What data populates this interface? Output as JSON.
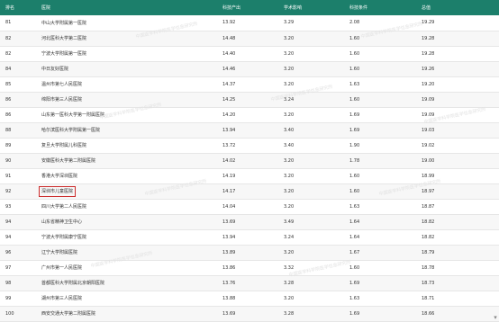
{
  "headers": [
    "排名",
    "医院",
    "科技产出",
    "学术影响",
    "科技条件",
    "总值"
  ],
  "rows": [
    {
      "rank": "81",
      "name": "中山大学附属第一医院",
      "a": "13.92",
      "b": "3.29",
      "c": "2.08",
      "d": "19.29"
    },
    {
      "rank": "82",
      "name": "河北医科大学第二医院",
      "a": "14.48",
      "b": "3.20",
      "c": "1.60",
      "d": "19.28"
    },
    {
      "rank": "82",
      "name": "宁波大学附属第一医院",
      "a": "14.40",
      "b": "3.20",
      "c": "1.60",
      "d": "19.28"
    },
    {
      "rank": "84",
      "name": "中日友好医院",
      "a": "14.46",
      "b": "3.20",
      "c": "1.60",
      "d": "19.26"
    },
    {
      "rank": "85",
      "name": "温州市第七人民医院",
      "a": "14.37",
      "b": "3.20",
      "c": "1.63",
      "d": "19.20"
    },
    {
      "rank": "86",
      "name": "绵阳市第三人民医院",
      "a": "14.25",
      "b": "3.24",
      "c": "1.60",
      "d": "19.09"
    },
    {
      "rank": "86",
      "name": "山东第一医科大学第一附属医院",
      "a": "14.20",
      "b": "3.20",
      "c": "1.69",
      "d": "19.09"
    },
    {
      "rank": "88",
      "name": "哈尔滨医科大学附属第一医院",
      "a": "13.94",
      "b": "3.40",
      "c": "1.69",
      "d": "19.03"
    },
    {
      "rank": "89",
      "name": "复旦大学附属儿科医院",
      "a": "13.72",
      "b": "3.40",
      "c": "1.90",
      "d": "19.02"
    },
    {
      "rank": "90",
      "name": "安徽医科大学第二附属医院",
      "a": "14.02",
      "b": "3.20",
      "c": "1.78",
      "d": "19.00"
    },
    {
      "rank": "91",
      "name": "香港大学深圳医院",
      "a": "14.19",
      "b": "3.20",
      "c": "1.60",
      "d": "18.99"
    },
    {
      "rank": "92",
      "name": "深圳市儿童医院",
      "a": "14.17",
      "b": "3.20",
      "c": "1.60",
      "d": "18.97"
    },
    {
      "rank": "93",
      "name": "四川大学第二人民医院",
      "a": "14.04",
      "b": "3.20",
      "c": "1.63",
      "d": "18.87"
    },
    {
      "rank": "94",
      "name": "山东省精神卫生中心",
      "a": "13.69",
      "b": "3.49",
      "c": "1.64",
      "d": "18.82"
    },
    {
      "rank": "94",
      "name": "宁波大学附属康宁医院",
      "a": "13.94",
      "b": "3.24",
      "c": "1.64",
      "d": "18.82"
    },
    {
      "rank": "96",
      "name": "辽宁大学附属医院",
      "a": "13.89",
      "b": "3.20",
      "c": "1.67",
      "d": "18.79"
    },
    {
      "rank": "97",
      "name": "广州市第一人民医院",
      "a": "13.86",
      "b": "3.32",
      "c": "1.60",
      "d": "18.78"
    },
    {
      "rank": "98",
      "name": "首都医科大学附属北京朝阳医院",
      "a": "13.76",
      "b": "3.28",
      "c": "1.69",
      "d": "18.73"
    },
    {
      "rank": "99",
      "name": "湖州市第三人民医院",
      "a": "13.88",
      "b": "3.20",
      "c": "1.63",
      "d": "18.71"
    },
    {
      "rank": "100",
      "name": "西安交通大学第二附属医院",
      "a": "13.69",
      "b": "3.28",
      "c": "1.69",
      "d": "18.66"
    }
  ],
  "highlighted_row_index": 11,
  "watermark": "中国医学科学院医学信息研究所",
  "colors": {
    "header_bg": "#1c7f6b",
    "highlight_border": "#cc2b2b"
  }
}
